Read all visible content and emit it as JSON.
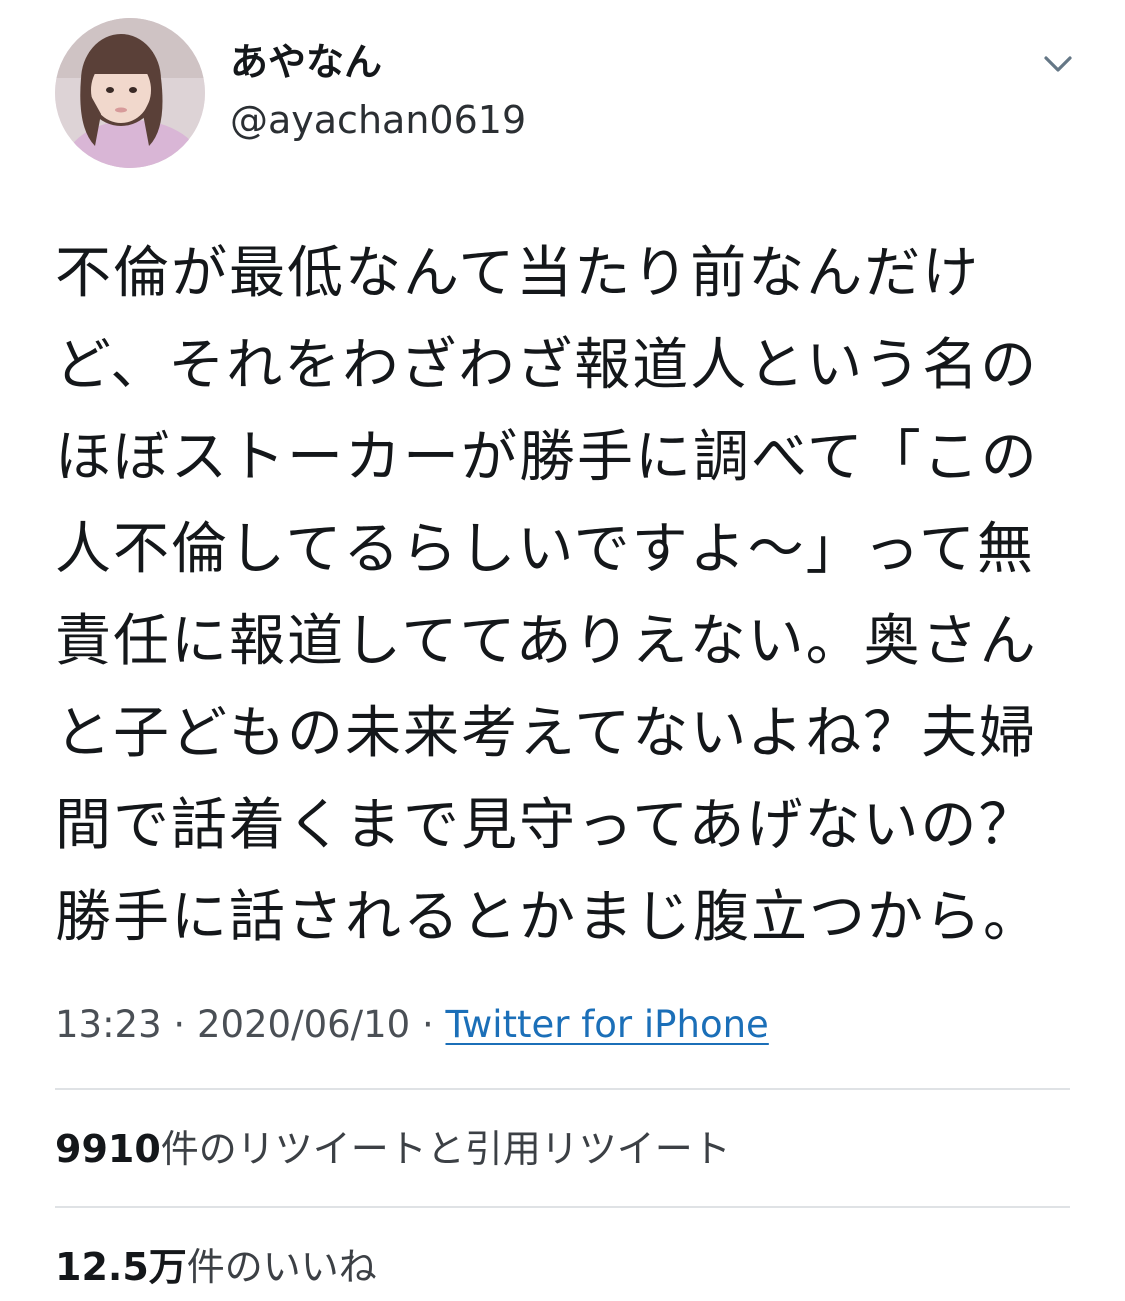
{
  "user": {
    "display_name": "あやなん",
    "handle": "@ayachan0619"
  },
  "tweet": {
    "lines": [
      "不倫が最低なんて当たり前なんだけ",
      "ど、それをわざわざ報道人という名の",
      "ほぼストーカーが勝手に調べて「この",
      "人不倫してるらしいですよ〜」って無",
      "責任に報道しててありえない。奥さん",
      "と子どもの未来考えてないよね？夫婦",
      "間で話着くまで見守ってあげないの？",
      "勝手に話されるとかまじ腹立つから。"
    ],
    "time": "13:23",
    "separator": "·",
    "date": "2020/06/10",
    "source": "Twitter for iPhone"
  },
  "stats": {
    "retweets_count": "9910",
    "retweets_label": "件のリツイートと引用リツイート",
    "likes_count": "12.5万",
    "likes_label": "件のいいね"
  },
  "icons": {
    "more": "chevron-down-icon",
    "avatar": "profile-photo"
  },
  "colors": {
    "link": "#1b6fb8",
    "divider": "#dfe2e5",
    "text": "#14171a"
  }
}
